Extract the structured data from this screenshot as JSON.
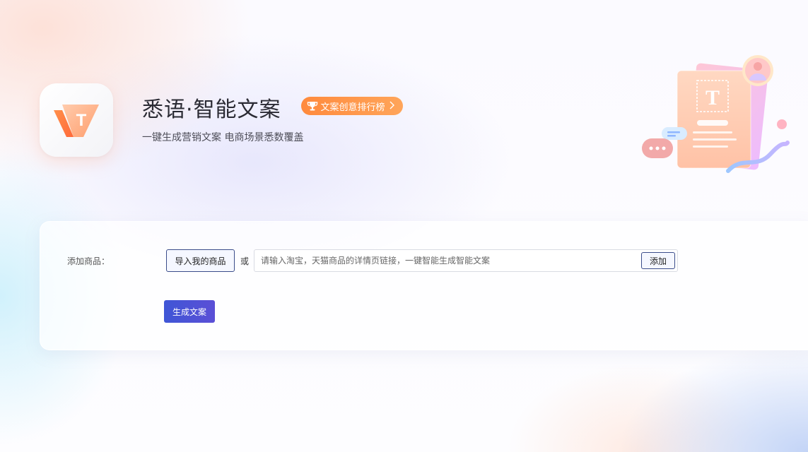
{
  "header": {
    "app_name": "悉语·智能文案",
    "rank_badge": "文案创意排行榜",
    "subtitle": "一键生成营销文案 电商场景悉数覆盖",
    "logo_letter": "T",
    "illustration_letter": "T"
  },
  "form": {
    "add_product_label": "添加商品：",
    "import_button": "导入我的商品",
    "or_text": "或",
    "url_placeholder": "请输入淘宝，天猫商品的详情页链接，一键智能生成智能文案",
    "url_value": "",
    "add_button": "添加",
    "generate_button": "生成文案"
  },
  "icons": {
    "logo": "app-logo-icon",
    "badge": "trophy-icon",
    "badge_arrow": "chevron-right-icon",
    "illustration": "document-text-illustration"
  },
  "colors": {
    "accent_orange": "#ff8a3d",
    "primary_blue": "#3f56d6",
    "button_border": "#3a4c8a"
  }
}
